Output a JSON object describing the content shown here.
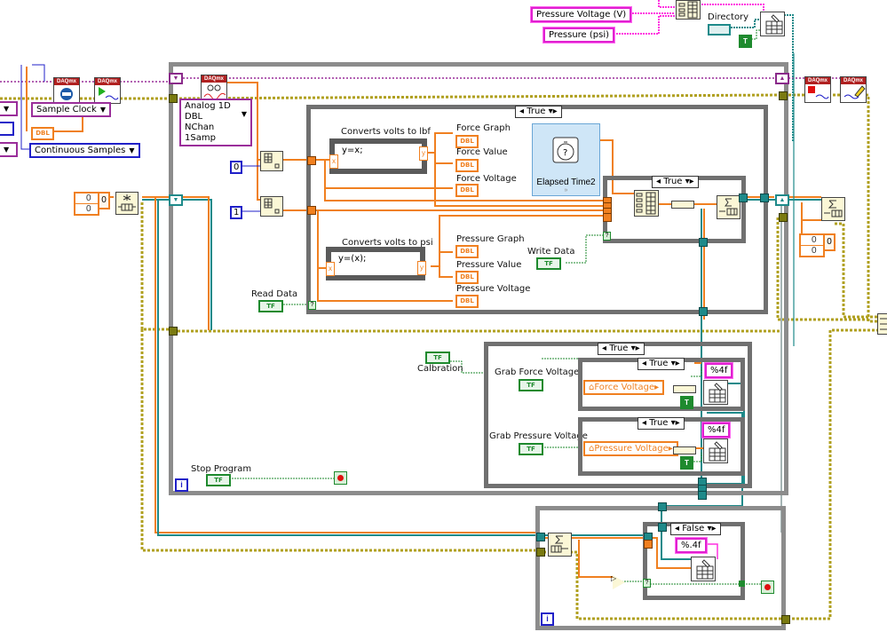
{
  "diagram": {
    "type": "LabVIEW block diagram",
    "top_right": {
      "string_constants": [
        "Pressure Voltage (V)",
        "Pressure (psi)"
      ],
      "directory_label": "Directory",
      "true_constant": "T"
    },
    "left_setup": {
      "timing_ring": "Sample Clock",
      "sample_mode_ring": "Continuous Samples",
      "dbl_indicator": "DBL",
      "daqmx_header": "DAQmx",
      "array_values": [
        "0",
        "0"
      ],
      "array_index": "0"
    },
    "main_loop": {
      "read_ring": "Analog 1D DBL\nNChan 1Samp",
      "index_constants": [
        "0",
        "1"
      ],
      "read_data_label": "Read Data",
      "write_data_label": "Write Data",
      "stop_label": "Stop Program",
      "calibration_label": "Calbration",
      "iteration_icon": "i",
      "read_case": {
        "selector": "True",
        "force_formula": {
          "title": "Converts volts to lbf",
          "expr": "y=x;",
          "in": "x",
          "out": "y"
        },
        "pressure_formula": {
          "title": "Converts volts to psi",
          "expr": "y=(x);",
          "in": "x",
          "out": "y"
        },
        "force_indicators": [
          "Force Graph",
          "Force Value",
          "Force Voltage"
        ],
        "pressure_indicators": [
          "Pressure Graph",
          "Pressure Value",
          "Pressure Voltage"
        ],
        "indicator_type": "DBL",
        "express_vi": "Elapsed Time2",
        "write_case_selector": "True"
      },
      "calibration_case": {
        "selector": "True",
        "grab_force_label": "Grab Force Voltage",
        "grab_pressure_label": "Grab  Pressure Voltage",
        "inner_force_case": {
          "selector": "True",
          "local_var": "Force Voltage",
          "format": "%4f"
        },
        "inner_pressure_case": {
          "selector": "True",
          "local_var": "Pressure Voltage",
          "format": "%4f"
        }
      }
    },
    "consumer_loop": {
      "case_selector": "False",
      "format": "%.4f",
      "iteration_icon": "i"
    },
    "right_side": {
      "array_values": [
        "0",
        "0"
      ],
      "array_index": "0"
    },
    "wire_colors": {
      "dbl": "#f08020",
      "bool": "#1e8a2e",
      "string": "#ff30e0",
      "path": "#1e8a8a",
      "error": "#b0a020",
      "task": "#9a2e9a",
      "int": "#2020c8"
    }
  }
}
